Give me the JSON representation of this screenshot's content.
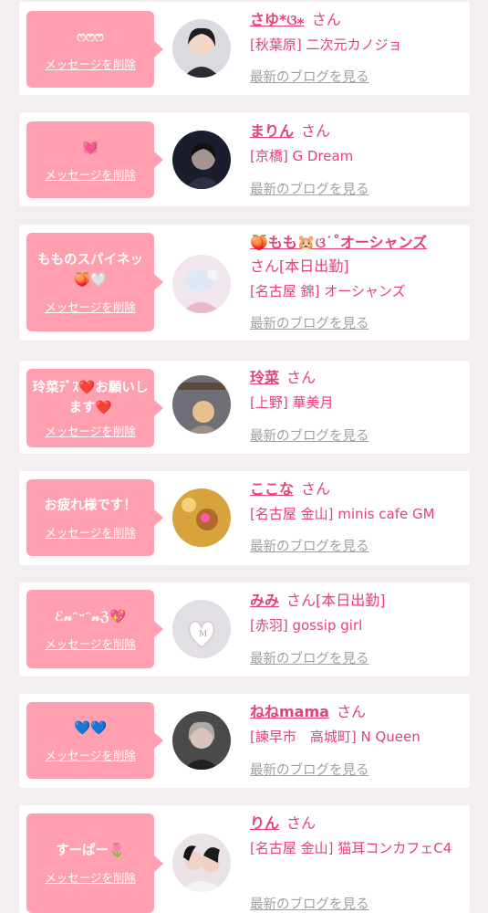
{
  "colors": {
    "background": "#f3eef0",
    "bubble": "#ff9fb0",
    "accent": "#e64173",
    "muted": "#a0a0a0"
  },
  "delete_label": "メッセージを削除",
  "blog_label": "最新のブログを見る",
  "items": [
    {
      "message": "ෆෆෆ",
      "name": "さゆ*ଓ⁎",
      "honorific": "さん",
      "shop": "[秋葉原] 二次元カノジョ",
      "avatar_icon": "avatar-icon"
    },
    {
      "message": "💓",
      "name": "まりん",
      "honorific": "さん",
      "shop": "[京橋] G Dream",
      "avatar_icon": "avatar-icon"
    },
    {
      "message": "もものスパイネッ🍑🤍",
      "name": "🍑もも🐹ଓ˙˚オーシャンズ",
      "honorific": "さん",
      "badge": "[本日出勤]",
      "shop": "[名古屋 錦] オーシャンズ",
      "avatar_icon": "avatar-icon"
    },
    {
      "message": "玲菜ﾃﾞｽ❤️お願いします❤️",
      "name": "玲菜",
      "honorific": "さん",
      "shop": "[上野] 華美月",
      "avatar_icon": "avatar-icon"
    },
    {
      "message": "お疲れ様です！",
      "name": "ここな",
      "honorific": "さん",
      "shop": "[名古屋 金山] minis cafe GM",
      "avatar_icon": "avatar-icon"
    },
    {
      "message": "ℰ𝓃ᵔᵕᵔ𝓃ℨ💖",
      "name": "みみ",
      "honorific": "さん",
      "badge": "[本日出勤]",
      "shop": "[赤羽] gossip girl",
      "avatar_icon": "avatar-icon"
    },
    {
      "message": "💙💙",
      "name": "ねねmama",
      "honorific": "さん",
      "shop": "[諫早市　高城町] N Queen",
      "avatar_icon": "avatar-icon"
    },
    {
      "message": "すーぱー🌷",
      "name": "りん",
      "honorific": "さん",
      "shop": "[名古屋 金山] 猫耳コンカフェC4",
      "avatar_icon": "avatar-icon"
    }
  ]
}
